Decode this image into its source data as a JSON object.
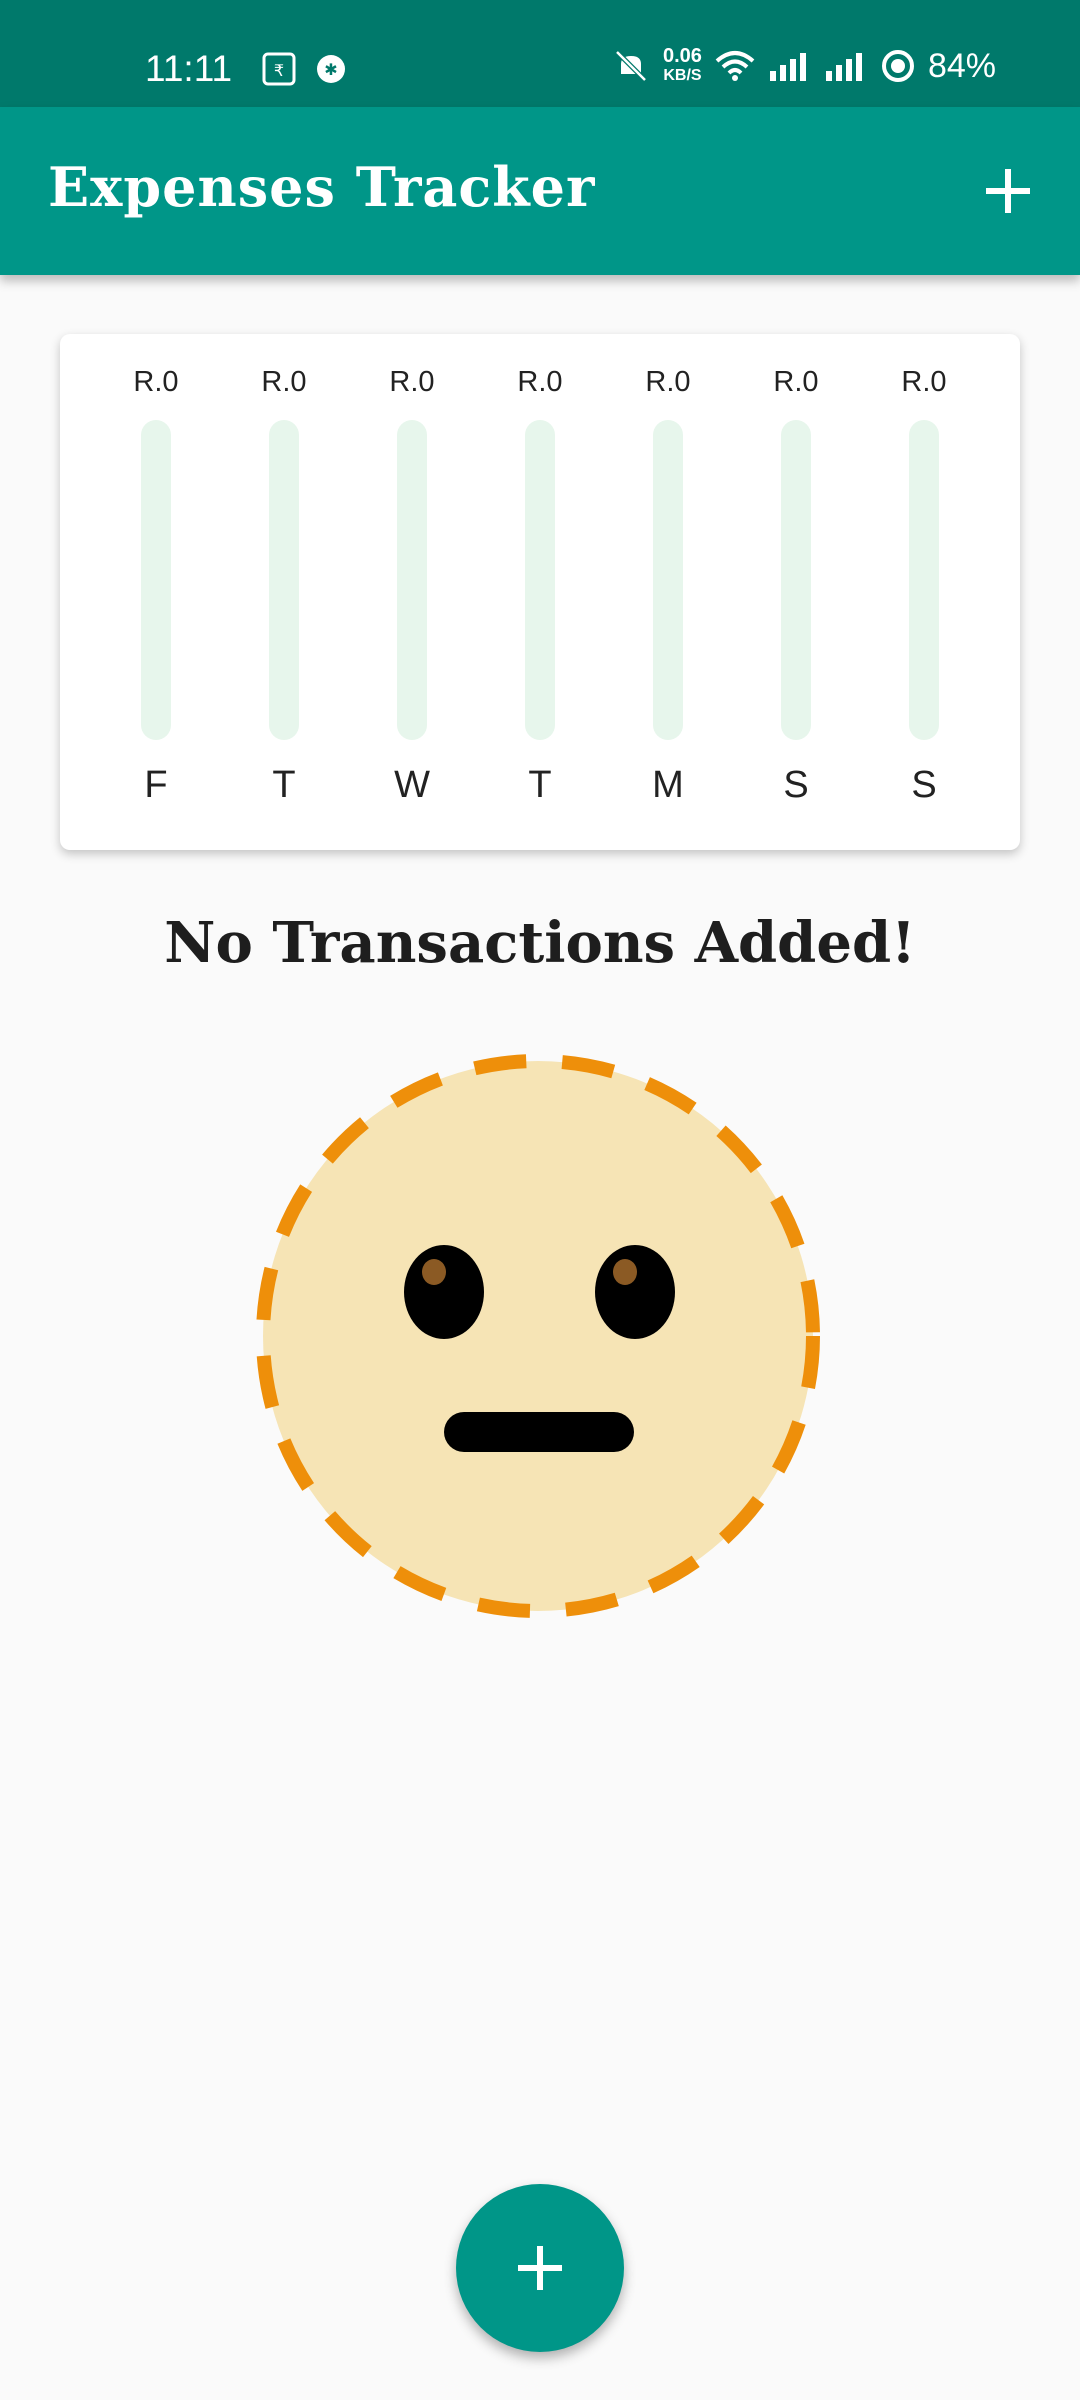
{
  "status_bar": {
    "time": "11:11",
    "speed_value": "0.06",
    "speed_unit": "KB/S",
    "battery": "84%"
  },
  "app_bar": {
    "title": "Expenses Tracker",
    "add_icon": "plus-icon"
  },
  "chart_data": {
    "type": "bar",
    "categories": [
      "F",
      "T",
      "W",
      "T",
      "M",
      "S",
      "S"
    ],
    "value_labels": [
      "R.0",
      "R.0",
      "R.0",
      "R.0",
      "R.0",
      "R.0",
      "R.0"
    ],
    "values": [
      0,
      0,
      0,
      0,
      0,
      0,
      0
    ],
    "track_color": "#e7f6ec",
    "fill_color": "#009688"
  },
  "empty_state": {
    "message": "No Transactions Added!",
    "image_icon": "neutral-face-icon"
  },
  "fab": {
    "icon": "plus-icon"
  },
  "colors": {
    "primary": "#009688",
    "status_bar": "#00796b",
    "emoji_face": "#f6e4b5",
    "emoji_border": "#ee8f0a"
  }
}
